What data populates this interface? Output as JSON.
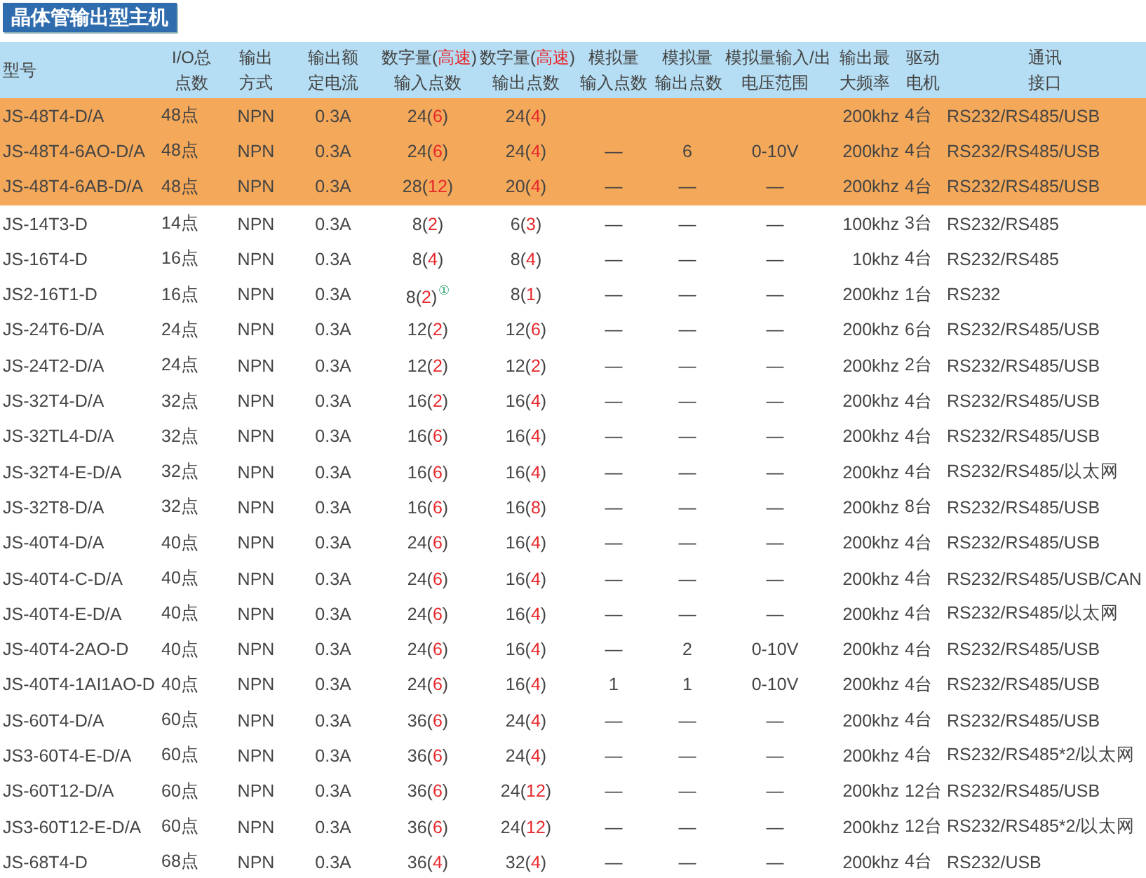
{
  "title": "晶体管输出型主机",
  "table": {
    "columns": [
      {
        "lines": [
          [
            "型号"
          ]
        ]
      },
      {
        "lines": [
          [
            "I/O总"
          ],
          [
            "点数"
          ]
        ]
      },
      {
        "lines": [
          [
            "输出"
          ],
          [
            "方式"
          ]
        ]
      },
      {
        "lines": [
          [
            "输出额"
          ],
          [
            "定电流"
          ]
        ]
      },
      {
        "lines": [
          [
            "数字量(",
            "高速",
            ")"
          ],
          [
            "输入点数"
          ]
        ]
      },
      {
        "lines": [
          [
            "数字量(",
            "高速",
            ")"
          ],
          [
            "输出点数"
          ]
        ]
      },
      {
        "lines": [
          [
            "模拟量"
          ],
          [
            "输入点数"
          ]
        ]
      },
      {
        "lines": [
          [
            "模拟量"
          ],
          [
            "输出点数"
          ]
        ]
      },
      {
        "lines": [
          [
            "模拟量输入/出"
          ],
          [
            "电压范围"
          ]
        ]
      },
      {
        "lines": [
          [
            "输出最"
          ],
          [
            "大频率"
          ]
        ]
      },
      {
        "lines": [
          [
            "驱动"
          ],
          [
            "电机"
          ]
        ]
      },
      {
        "lines": [
          [
            "通讯"
          ],
          [
            "接口"
          ]
        ]
      }
    ],
    "rows": [
      {
        "highlighted": true,
        "cells": [
          "JS-48T4-D/A",
          "48点",
          "NPN",
          "0.3A",
          {
            "parts": [
              "24(",
              "6",
              ")"
            ]
          },
          {
            "parts": [
              "24(",
              "4",
              ")"
            ]
          },
          null,
          null,
          null,
          "200khz",
          "4台",
          "RS232/RS485/USB"
        ]
      },
      {
        "highlighted": true,
        "cells": [
          "JS-48T4-6AO-D/A",
          "48点",
          "NPN",
          "0.3A",
          {
            "parts": [
              "24(",
              "6",
              ")"
            ]
          },
          {
            "parts": [
              "24(",
              "4",
              ")"
            ]
          },
          "—",
          "6",
          "0-10V",
          "200khz",
          "4台",
          "RS232/RS485/USB"
        ]
      },
      {
        "highlighted": true,
        "cells": [
          "JS-48T4-6AB-D/A",
          "48点",
          "NPN",
          "0.3A",
          {
            "parts": [
              "28(",
              "12",
              ")"
            ]
          },
          {
            "parts": [
              "20(",
              "4",
              ")"
            ]
          },
          "—",
          "—",
          "—",
          "200khz",
          "4台",
          "RS232/RS485/USB"
        ]
      },
      {
        "highlighted": false,
        "cells": [
          "JS-14T3-D",
          "14点",
          "NPN",
          "0.3A",
          {
            "parts": [
              "8(",
              "2",
              ")"
            ]
          },
          {
            "parts": [
              "6(",
              "3",
              ")"
            ]
          },
          "—",
          "—",
          "—",
          "100khz",
          "3台",
          "RS232/RS485"
        ]
      },
      {
        "highlighted": false,
        "cells": [
          "JS-16T4-D",
          "16点",
          "NPN",
          "0.3A",
          {
            "parts": [
              "8(",
              "4",
              ")"
            ]
          },
          {
            "parts": [
              "8(",
              "4",
              ")"
            ]
          },
          "—",
          "—",
          "—",
          "10khz",
          "4台",
          "RS232/RS485"
        ]
      },
      {
        "highlighted": false,
        "cells": [
          "JS2-16T1-D",
          "16点",
          "NPN",
          "0.3A",
          {
            "parts": [
              "8(",
              "2",
              ")"
            ],
            "note": "①"
          },
          {
            "parts": [
              "8(",
              "1",
              ")"
            ]
          },
          "—",
          "—",
          "—",
          "200khz",
          "1台",
          "RS232"
        ]
      },
      {
        "highlighted": false,
        "cells": [
          "JS-24T6-D/A",
          "24点",
          "NPN",
          "0.3A",
          {
            "parts": [
              "12(",
              "2",
              ")"
            ]
          },
          {
            "parts": [
              "12(",
              "6",
              ")"
            ]
          },
          "—",
          "—",
          "—",
          "200khz",
          "6台",
          "RS232/RS485/USB"
        ]
      },
      {
        "highlighted": false,
        "cells": [
          "JS-24T2-D/A",
          "24点",
          "NPN",
          "0.3A",
          {
            "parts": [
              "12(",
              "2",
              ")"
            ]
          },
          {
            "parts": [
              "12(",
              "2",
              ")"
            ]
          },
          "—",
          "—",
          "—",
          "200khz",
          "2台",
          "RS232/RS485/USB"
        ]
      },
      {
        "highlighted": false,
        "cells": [
          "JS-32T4-D/A",
          "32点",
          "NPN",
          "0.3A",
          {
            "parts": [
              "16(",
              "2",
              ")"
            ]
          },
          {
            "parts": [
              "16(",
              "4",
              ")"
            ]
          },
          "—",
          "—",
          "—",
          "200khz",
          "4台",
          "RS232/RS485/USB"
        ]
      },
      {
        "highlighted": false,
        "cells": [
          "JS-32TL4-D/A",
          "32点",
          "NPN",
          "0.3A",
          {
            "parts": [
              "16(",
              "6",
              ")"
            ]
          },
          {
            "parts": [
              "16(",
              "4",
              ")"
            ]
          },
          "—",
          "—",
          "—",
          "200khz",
          "4台",
          "RS232/RS485/USB"
        ]
      },
      {
        "highlighted": false,
        "cells": [
          "JS-32T4-E-D/A",
          "32点",
          "NPN",
          "0.3A",
          {
            "parts": [
              "16(",
              "6",
              ")"
            ]
          },
          {
            "parts": [
              "16(",
              "4",
              ")"
            ]
          },
          "—",
          "—",
          "—",
          "200khz",
          "4台",
          "RS232/RS485/以太网"
        ]
      },
      {
        "highlighted": false,
        "cells": [
          "JS-32T8-D/A",
          "32点",
          "NPN",
          "0.3A",
          {
            "parts": [
              "16(",
              "6",
              ")"
            ]
          },
          {
            "parts": [
              "16(",
              "8",
              ")"
            ]
          },
          "—",
          "—",
          "—",
          "200khz",
          "8台",
          "RS232/RS485/USB"
        ]
      },
      {
        "highlighted": false,
        "cells": [
          "JS-40T4-D/A",
          "40点",
          "NPN",
          "0.3A",
          {
            "parts": [
              "24(",
              "6",
              ")"
            ]
          },
          {
            "parts": [
              "16(",
              "4",
              ")"
            ]
          },
          "—",
          "—",
          "—",
          "200khz",
          "4台",
          "RS232/RS485/USB"
        ]
      },
      {
        "highlighted": false,
        "cells": [
          "JS-40T4-C-D/A",
          "40点",
          "NPN",
          "0.3A",
          {
            "parts": [
              "24(",
              "6",
              ")"
            ]
          },
          {
            "parts": [
              "16(",
              "4",
              ")"
            ]
          },
          "—",
          "—",
          "—",
          "200khz",
          "4台",
          "RS232/RS485/USB/CAN"
        ]
      },
      {
        "highlighted": false,
        "cells": [
          "JS-40T4-E-D/A",
          "40点",
          "NPN",
          "0.3A",
          {
            "parts": [
              "24(",
              "6",
              ")"
            ]
          },
          {
            "parts": [
              "16(",
              "4",
              ")"
            ]
          },
          "—",
          "—",
          "—",
          "200khz",
          "4台",
          "RS232/RS485/以太网"
        ]
      },
      {
        "highlighted": false,
        "cells": [
          "JS-40T4-2AO-D",
          "40点",
          "NPN",
          "0.3A",
          {
            "parts": [
              "24(",
              "6",
              ")"
            ]
          },
          {
            "parts": [
              "16(",
              "4",
              ")"
            ]
          },
          "—",
          "2",
          "0-10V",
          "200khz",
          "4台",
          "RS232/RS485/USB"
        ]
      },
      {
        "highlighted": false,
        "cells": [
          "JS-40T4-1AI1AO-D",
          "40点",
          "NPN",
          "0.3A",
          {
            "parts": [
              "24(",
              "6",
              ")"
            ]
          },
          {
            "parts": [
              "16(",
              "4",
              ")"
            ]
          },
          "1",
          "1",
          "0-10V",
          "200khz",
          "4台",
          "RS232/RS485/USB"
        ]
      },
      {
        "highlighted": false,
        "cells": [
          "JS-60T4-D/A",
          "60点",
          "NPN",
          "0.3A",
          {
            "parts": [
              "36(",
              "6",
              ")"
            ]
          },
          {
            "parts": [
              "24(",
              "4",
              ")"
            ]
          },
          "—",
          "—",
          "—",
          "200khz",
          "4台",
          "RS232/RS485/USB"
        ]
      },
      {
        "highlighted": false,
        "cells": [
          "JS3-60T4-E-D/A",
          "60点",
          "NPN",
          "0.3A",
          {
            "parts": [
              "36(",
              "6",
              ")"
            ]
          },
          {
            "parts": [
              "24(",
              "4",
              ")"
            ]
          },
          "—",
          "—",
          "—",
          "200khz",
          "4台",
          "RS232/RS485*2/以太网"
        ]
      },
      {
        "highlighted": false,
        "cells": [
          "JS-60T12-D/A",
          "60点",
          "NPN",
          "0.3A",
          {
            "parts": [
              "36(",
              "6",
              ")"
            ]
          },
          {
            "parts": [
              "24(",
              "12",
              ")"
            ]
          },
          "—",
          "—",
          "—",
          "200khz",
          "12台",
          "RS232/RS485/USB"
        ]
      },
      {
        "highlighted": false,
        "cells": [
          "JS3-60T12-E-D/A",
          "60点",
          "NPN",
          "0.3A",
          {
            "parts": [
              "36(",
              "6",
              ")"
            ]
          },
          {
            "parts": [
              "24(",
              "12",
              ")"
            ]
          },
          "—",
          "—",
          "—",
          "200khz",
          "12台",
          "RS232/RS485*2/以太网"
        ]
      },
      {
        "highlighted": false,
        "cells": [
          "JS-68T4-D",
          "68点",
          "NPN",
          "0.3A",
          {
            "parts": [
              "36(",
              "4",
              ")"
            ]
          },
          {
            "parts": [
              "32(",
              "4",
              ")"
            ]
          },
          "—",
          "—",
          "—",
          "200khz",
          "4台",
          "RS232/USB"
        ]
      }
    ]
  }
}
